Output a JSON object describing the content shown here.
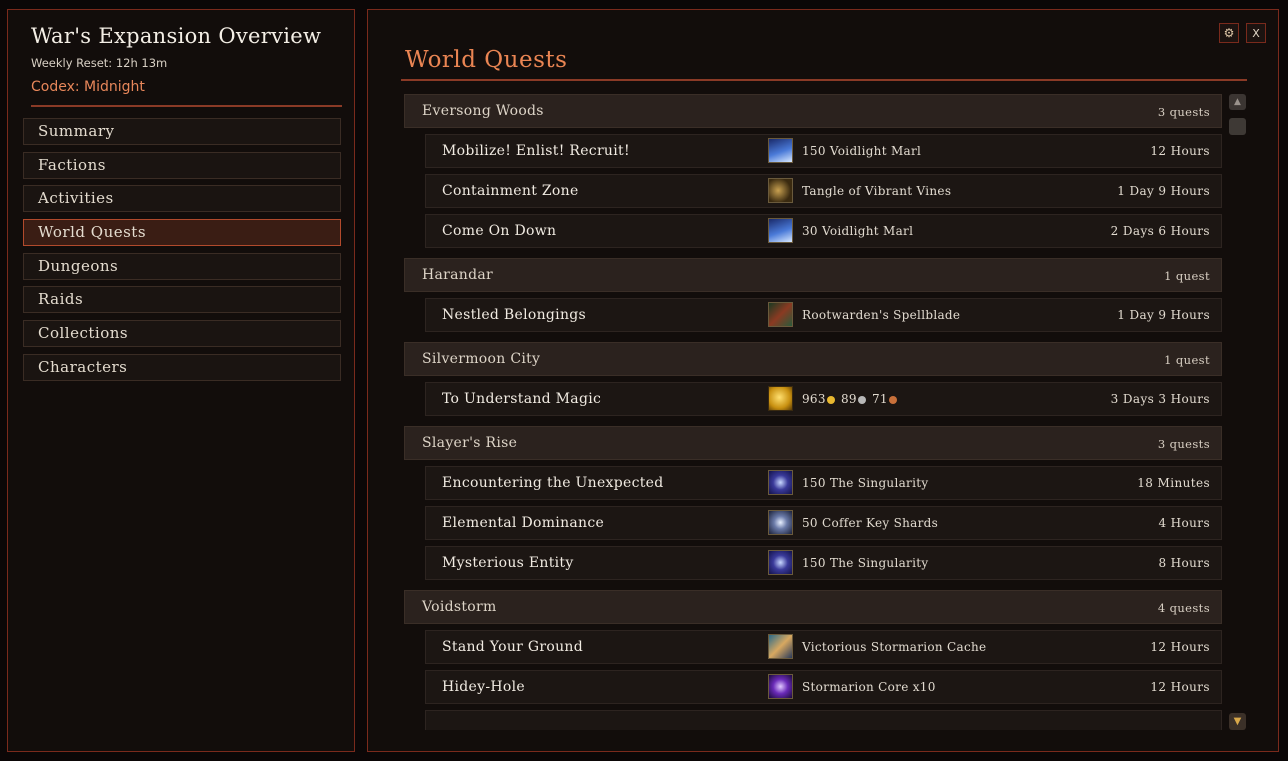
{
  "left": {
    "title": "War's Expansion Overview",
    "weekly_reset": "Weekly Reset: 12h 13m",
    "codex": "Codex: Midnight",
    "nav": [
      "Summary",
      "Factions",
      "Activities",
      "World Quests",
      "Dungeons",
      "Raids",
      "Collections",
      "Characters"
    ],
    "active_nav": "World Quests"
  },
  "right": {
    "title": "World Quests",
    "close_label": "X",
    "zones": [
      {
        "name": "Eversong Woods",
        "count": "3 quests",
        "quests": [
          {
            "name": "Mobilize! Enlist! Recruit!",
            "reward": "150 Voidlight Marl",
            "time": "12 Hours",
            "icon": "voidlight-marl-icon"
          },
          {
            "name": "Containment Zone",
            "reward": "Tangle of Vibrant Vines",
            "time": "1 Day 9 Hours",
            "icon": "vines-icon"
          },
          {
            "name": "Come On Down",
            "reward": "30 Voidlight Marl",
            "time": "2 Days 6 Hours",
            "icon": "voidlight-marl-icon"
          }
        ]
      },
      {
        "name": "Harandar",
        "count": "1 quest",
        "quests": [
          {
            "name": "Nestled Belongings",
            "reward": "Rootwarden's Spellblade",
            "time": "1 Day 9 Hours",
            "icon": "spellblade-icon"
          }
        ]
      },
      {
        "name": "Silvermoon City",
        "count": "1 quest",
        "quests": [
          {
            "name": "To Understand Magic",
            "reward_gold": "963",
            "reward_silver": "89",
            "reward_copper": "71",
            "time": "3 Days 3 Hours",
            "icon": "gold-icon"
          }
        ]
      },
      {
        "name": "Slayer's Rise",
        "count": "3 quests",
        "quests": [
          {
            "name": "Encountering the Unexpected",
            "reward": "150 The Singularity",
            "time": "18 Minutes",
            "icon": "singularity-icon"
          },
          {
            "name": "Elemental Dominance",
            "reward": "50 Coffer Key Shards",
            "time": "4 Hours",
            "icon": "coffer-key-icon"
          },
          {
            "name": "Mysterious Entity",
            "reward": "150 The Singularity",
            "time": "8 Hours",
            "icon": "singularity-icon"
          }
        ]
      },
      {
        "name": "Voidstorm",
        "count": "4 quests",
        "quests": [
          {
            "name": "Stand Your Ground",
            "reward": "Victorious Stormarion Cache",
            "time": "12 Hours",
            "icon": "cache-icon"
          },
          {
            "name": "Hidey-Hole",
            "reward": "Stormarion Core x10",
            "time": "12 Hours",
            "icon": "stormarion-core-icon"
          }
        ]
      }
    ]
  },
  "colors": {
    "accent": "#ea8553",
    "border": "#7a2a1c",
    "gold": "#e8b830",
    "silver": "#b8b8b8",
    "copper": "#c8703a"
  }
}
